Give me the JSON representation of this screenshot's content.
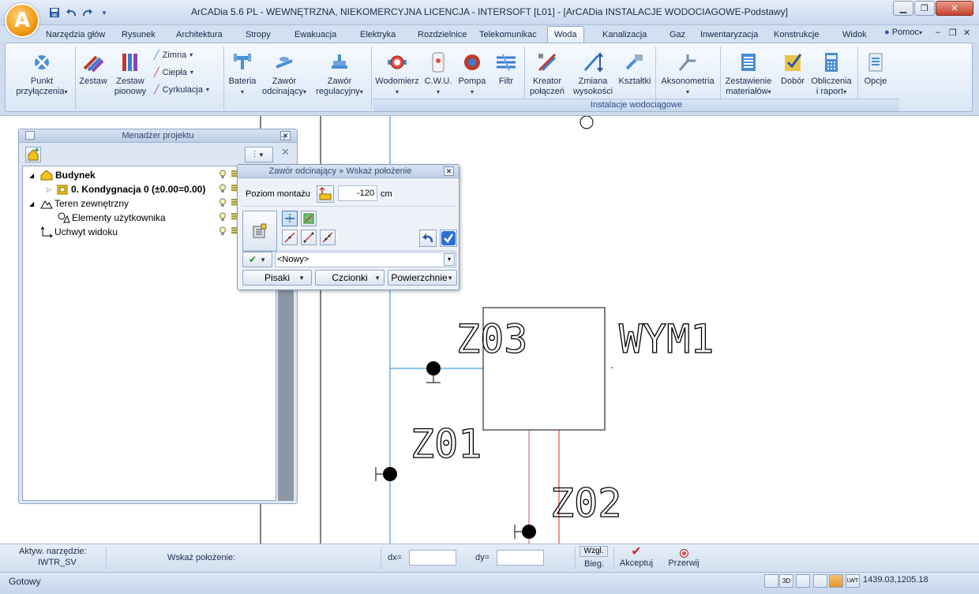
{
  "titlebar": {
    "title": "ArCADia 5.6 PL - WEWNĘTRZNA, NIEKOMERCYJNA LICENCJA - INTERSOFT [L01] - [ArCADia INSTALACJE WODOCIAGOWE-Podstawy]",
    "app_letter": "A"
  },
  "tabs": [
    "Narzędzia głów",
    "Rysunek",
    "Architektura",
    "Stropy",
    "Ewakuacja",
    "Elektryka",
    "Rozdzielnice",
    "Telekomunikac",
    "Woda",
    "Kanalizacja",
    "Gaz",
    "Inwentaryzacja",
    "Konstrukcje",
    "Widok"
  ],
  "active_tab": "Woda",
  "help_label": "Pomoc",
  "ribbon": {
    "punkt": "Punkt\nprzyłączenia",
    "zestaw": "Zestaw",
    "zestaw_pionowy": "Zestaw\npionowy",
    "zimna": "Zimna",
    "ciepla": "Ciepła",
    "cyrkulacja": "Cyrkulacja",
    "bateria": "Bateria",
    "zawor_odc": "Zawór\nodcinający",
    "zawor_reg": "Zawór\nregulacyjny",
    "wodomierz": "Wodomierz",
    "cwu": "C.W.U.",
    "pompa": "Pompa",
    "filtr": "Filtr",
    "kreator": "Kreator\npołączeń",
    "zmiana": "Zmiana\nwysokości",
    "ksztaltki": "Kształtki",
    "aksonometria": "Aksonometria",
    "zestawienie": "Zestawienie\nmateriałów",
    "dobor": "Dobór",
    "obliczenia": "Obliczenia\ni raport",
    "opcje": "Opcje",
    "group_label": "Instalacje wodociągowe"
  },
  "project_manager": {
    "title": "Menadżer projektu",
    "items": [
      {
        "label": "Budynek",
        "bold": true
      },
      {
        "label": "0. Kondygnacja 0 (±0.00=0.00)",
        "bold": true
      },
      {
        "label": "Teren zewnętrzny",
        "bold": false
      },
      {
        "label": "Elementy użytkownika",
        "bold": false
      },
      {
        "label": "Uchwyt widoku",
        "bold": false
      }
    ]
  },
  "dialog": {
    "title": "Zawór odcinający » Wskaż położenie",
    "poziom_label": "Poziom montażu",
    "poziom_value": "-120",
    "poziom_unit": "cm",
    "style_value": "<Nowy>",
    "pisaki": "Pisaki",
    "czcionki": "Czcionki",
    "powierzchnie": "Powierzchnie"
  },
  "drawing": {
    "label_z03": "Z03",
    "label_wym1": "WYM1",
    "label_z01": "Z01",
    "label_z02": "Z02"
  },
  "cmdbar": {
    "tool_label": "Aktyw. narzędzie:",
    "tool_value": "IWTR_SV",
    "prompt": "Wskaż położenie:",
    "dx_label": "dx=",
    "dy_label": "dy=",
    "wzgl": "Wzgl.",
    "bieg": "Bieg.",
    "akceptuj": "Akceptuj",
    "przerwij": "Przerwij"
  },
  "statusbar": {
    "status": "Gotowy",
    "coords": "1439.03,1205.18"
  },
  "colors": {
    "pipe_blue": "#1a8fd8",
    "pipe_red": "#d42a2a",
    "accent": "#2b58a4"
  }
}
